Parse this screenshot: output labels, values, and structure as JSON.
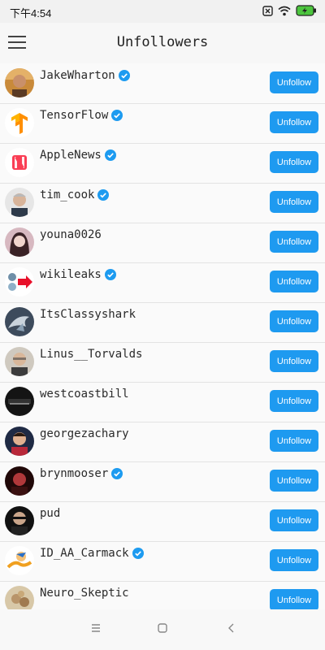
{
  "status_bar": {
    "time": "下午4:54"
  },
  "app_bar": {
    "title": "Unfollowers",
    "menu_icon": "hamburger-menu-icon"
  },
  "unfollow_label": "Unfollow",
  "colors": {
    "accent": "#1e9af0",
    "verified": "#1d9bf0"
  },
  "users": [
    {
      "username": "JakeWharton",
      "verified": true
    },
    {
      "username": "TensorFlow",
      "verified": true
    },
    {
      "username": "AppleNews",
      "verified": true
    },
    {
      "username": "tim_cook",
      "verified": true
    },
    {
      "username": "youna0026",
      "verified": false
    },
    {
      "username": "wikileaks",
      "verified": true
    },
    {
      "username": "ItsClassyshark",
      "verified": false
    },
    {
      "username": "Linus__Torvalds",
      "verified": false
    },
    {
      "username": "westcoastbill",
      "verified": false
    },
    {
      "username": "georgezachary",
      "verified": false
    },
    {
      "username": "brynmooser",
      "verified": true
    },
    {
      "username": "pud",
      "verified": false
    },
    {
      "username": "ID_AA_Carmack",
      "verified": true
    },
    {
      "username": "Neuro_Skeptic",
      "verified": false
    }
  ]
}
